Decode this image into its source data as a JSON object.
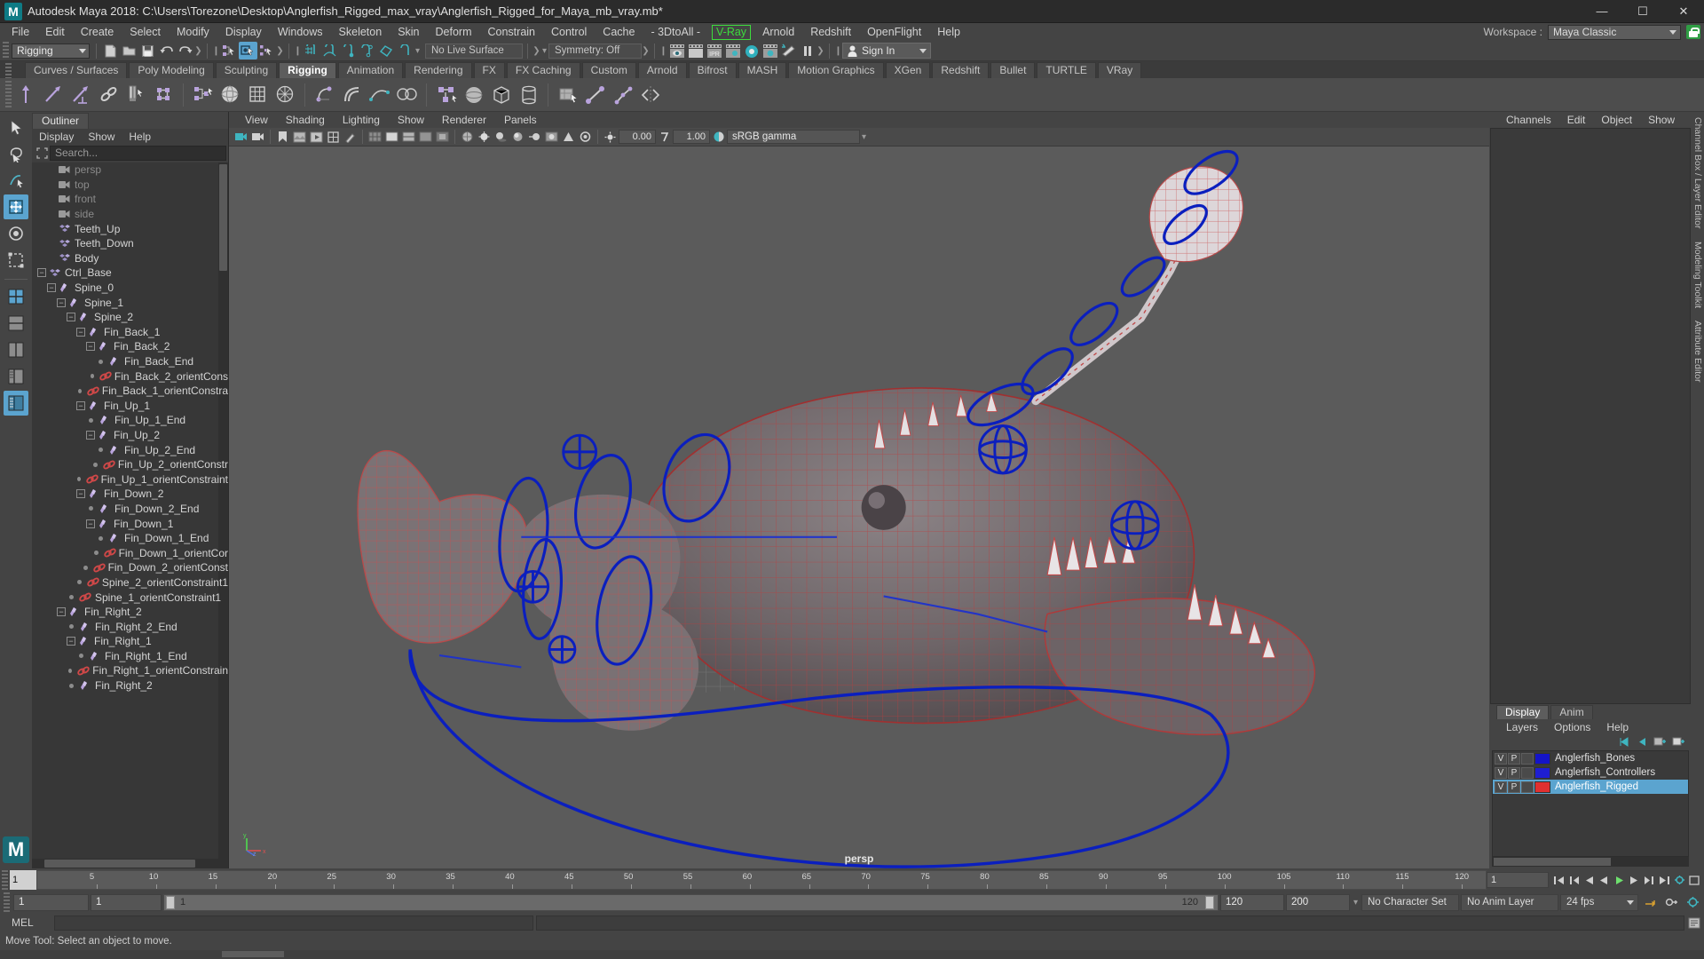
{
  "window": {
    "title": "Autodesk Maya 2018: C:\\Users\\Torezone\\Desktop\\Anglerfish_Rigged_max_vray\\Anglerfish_Rigged_for_Maya_mb_vray.mb*",
    "logo": "M",
    "minimize": "—",
    "maximize": "☐",
    "close": "✕"
  },
  "menubar": {
    "items": [
      "File",
      "Edit",
      "Create",
      "Select",
      "Modify",
      "Display",
      "Windows",
      "Skeleton",
      "Skin",
      "Deform",
      "Constrain",
      "Control",
      "Cache",
      "- 3DtoAll -"
    ],
    "vray": "V-Ray",
    "after_vray": [
      "Arnold",
      "Redshift",
      "OpenFlight",
      "Help"
    ],
    "workspace_label": "Workspace :",
    "workspace_value": "Maya Classic",
    "vray_color": "#3ddc3d"
  },
  "toolbar": {
    "menuset": "Rigging",
    "live_surface": "No Live Surface",
    "symmetry": "Symmetry: Off",
    "signin": "Sign In"
  },
  "shelf": {
    "tabs": [
      "Curves / Surfaces",
      "Poly Modeling",
      "Sculpting",
      "Rigging",
      "Animation",
      "Rendering",
      "FX",
      "FX Caching",
      "Custom",
      "Arnold",
      "Bifrost",
      "MASH",
      "Motion Graphics",
      "XGen",
      "Redshift",
      "Bullet",
      "TURTLE",
      "VRay"
    ],
    "active_tab": "Rigging"
  },
  "outliner": {
    "tab": "Outliner",
    "menus": [
      "Display",
      "Show",
      "Help"
    ],
    "search_placeholder": "Search...",
    "items": [
      {
        "label": "persp",
        "depth": 2,
        "icon": "camera",
        "expand": "none",
        "dim": true
      },
      {
        "label": "top",
        "depth": 2,
        "icon": "camera",
        "expand": "none",
        "dim": true
      },
      {
        "label": "front",
        "depth": 2,
        "icon": "camera",
        "expand": "none",
        "dim": true
      },
      {
        "label": "side",
        "depth": 2,
        "icon": "camera",
        "expand": "none",
        "dim": true
      },
      {
        "label": "Teeth_Up",
        "depth": 2,
        "icon": "mesh",
        "expand": "none",
        "dim": false
      },
      {
        "label": "Teeth_Down",
        "depth": 2,
        "icon": "mesh",
        "expand": "none",
        "dim": false
      },
      {
        "label": "Body",
        "depth": 2,
        "icon": "mesh",
        "expand": "none",
        "dim": false
      },
      {
        "label": "Ctrl_Base",
        "depth": 1,
        "icon": "mesh",
        "expand": "minus",
        "dim": false
      },
      {
        "label": "Spine_0",
        "depth": 2,
        "icon": "joint",
        "expand": "minus",
        "dim": false
      },
      {
        "label": "Spine_1",
        "depth": 3,
        "icon": "joint",
        "expand": "minus",
        "dim": false
      },
      {
        "label": "Spine_2",
        "depth": 4,
        "icon": "joint",
        "expand": "minus",
        "dim": false
      },
      {
        "label": "Fin_Back_1",
        "depth": 5,
        "icon": "joint",
        "expand": "minus",
        "dim": false
      },
      {
        "label": "Fin_Back_2",
        "depth": 6,
        "icon": "joint",
        "expand": "minus",
        "dim": false
      },
      {
        "label": "Fin_Back_End",
        "depth": 7,
        "icon": "joint",
        "expand": "dot",
        "dim": false
      },
      {
        "label": "Fin_Back_2_orientCons",
        "depth": 7,
        "icon": "constraint",
        "expand": "dot",
        "dim": false
      },
      {
        "label": "Fin_Back_1_orientConstra",
        "depth": 6,
        "icon": "constraint",
        "expand": "dot",
        "dim": false
      },
      {
        "label": "Fin_Up_1",
        "depth": 5,
        "icon": "joint",
        "expand": "minus",
        "dim": false
      },
      {
        "label": "Fin_Up_1_End",
        "depth": 6,
        "icon": "joint",
        "expand": "dot",
        "dim": false
      },
      {
        "label": "Fin_Up_2",
        "depth": 6,
        "icon": "joint",
        "expand": "minus",
        "dim": false
      },
      {
        "label": "Fin_Up_2_End",
        "depth": 7,
        "icon": "joint",
        "expand": "dot",
        "dim": false
      },
      {
        "label": "Fin_Up_2_orientConstr",
        "depth": 7,
        "icon": "constraint",
        "expand": "dot",
        "dim": false
      },
      {
        "label": "Fin_Up_1_orientConstraint",
        "depth": 6,
        "icon": "constraint",
        "expand": "dot",
        "dim": false
      },
      {
        "label": "Fin_Down_2",
        "depth": 5,
        "icon": "joint",
        "expand": "minus",
        "dim": false
      },
      {
        "label": "Fin_Down_2_End",
        "depth": 6,
        "icon": "joint",
        "expand": "dot",
        "dim": false
      },
      {
        "label": "Fin_Down_1",
        "depth": 6,
        "icon": "joint",
        "expand": "minus",
        "dim": false
      },
      {
        "label": "Fin_Down_1_End",
        "depth": 7,
        "icon": "joint",
        "expand": "dot",
        "dim": false
      },
      {
        "label": "Fin_Down_1_orientCor",
        "depth": 7,
        "icon": "constraint",
        "expand": "dot",
        "dim": false
      },
      {
        "label": "Fin_Down_2_orientConst",
        "depth": 6,
        "icon": "constraint",
        "expand": "dot",
        "dim": false
      },
      {
        "label": "Spine_2_orientConstraint1",
        "depth": 5,
        "icon": "constraint",
        "expand": "dot",
        "dim": false
      },
      {
        "label": "Spine_1_orientConstraint1",
        "depth": 4,
        "icon": "constraint",
        "expand": "dot",
        "dim": false
      },
      {
        "label": "Fin_Right_2",
        "depth": 3,
        "icon": "joint",
        "expand": "minus",
        "dim": false
      },
      {
        "label": "Fin_Right_2_End",
        "depth": 4,
        "icon": "joint",
        "expand": "dot",
        "dim": false
      },
      {
        "label": "Fin_Right_1",
        "depth": 4,
        "icon": "joint",
        "expand": "minus",
        "dim": false
      },
      {
        "label": "Fin_Right_1_End",
        "depth": 5,
        "icon": "joint",
        "expand": "dot",
        "dim": false
      },
      {
        "label": "Fin_Right_1_orientConstrain",
        "depth": 5,
        "icon": "constraint",
        "expand": "dot",
        "dim": false
      },
      {
        "label": "Fin_Right_2",
        "depth": 4,
        "icon": "joint",
        "expand": "dot",
        "dim": false
      }
    ]
  },
  "viewport": {
    "menus": [
      "View",
      "Shading",
      "Lighting",
      "Show",
      "Renderer",
      "Panels"
    ],
    "exposure": "0.00",
    "gamma_value": "1.00",
    "color_management": "sRGB gamma",
    "camera_label": "persp"
  },
  "rightpanel": {
    "top_menus": [
      "Channels",
      "Edit",
      "Object",
      "Show"
    ],
    "tabs": [
      "Display",
      "Anim"
    ],
    "active_tab": "Display",
    "sub_menus": [
      "Layers",
      "Options",
      "Help"
    ],
    "layers": [
      {
        "v": "V",
        "p": "P",
        "color": "#1414c8",
        "name": "Anglerfish_Bones",
        "selected": false
      },
      {
        "v": "V",
        "p": "P",
        "color": "#1e1ed2",
        "name": "Anglerfish_Controllers",
        "selected": false
      },
      {
        "v": "V",
        "p": "P",
        "color": "#e03030",
        "name": "Anglerfish_Rigged",
        "selected": true
      }
    ],
    "vertical_tabs": [
      "Channel Box / Layer Editor",
      "Modeling Toolkit",
      "Attribute Editor"
    ]
  },
  "timeslider": {
    "current_frame": "1",
    "ticks": [
      "5",
      "10",
      "15",
      "20",
      "25",
      "30",
      "35",
      "40",
      "45",
      "50",
      "55",
      "60",
      "65",
      "70",
      "75",
      "80",
      "85",
      "90",
      "95",
      "100",
      "105",
      "110",
      "115",
      "120"
    ],
    "end_field": "1"
  },
  "rangeslider": {
    "start": "1",
    "anim_start": "1",
    "range_left_label": "1",
    "range_right_label": "120",
    "anim_end": "120",
    "end": "200",
    "character_set": "No Character Set",
    "anim_layer": "No Anim Layer",
    "fps": "24 fps"
  },
  "commandline": {
    "mel_label": "MEL",
    "input_value": "",
    "output_value": ""
  },
  "statusbar": {
    "help_text": "Move Tool: Select an object to move."
  }
}
